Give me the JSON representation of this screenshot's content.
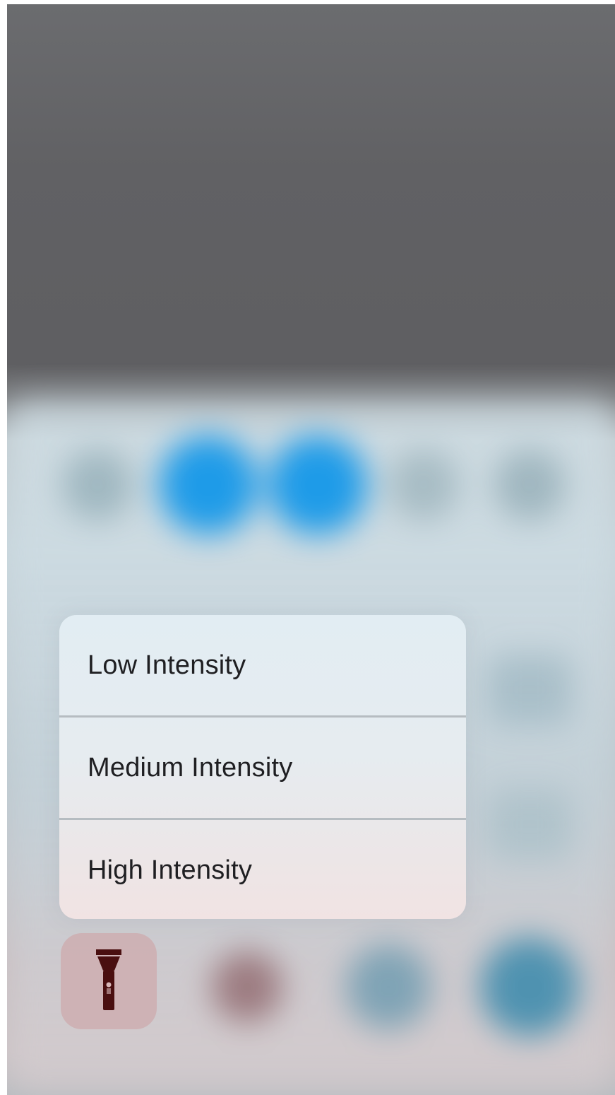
{
  "colors": {
    "accent_blue": "#1e9be8",
    "flashlight_icon": "#4a0f10",
    "menu_text": "#1f1f22",
    "divider": "#b6bcc1"
  },
  "intensity_menu": {
    "items": [
      {
        "label": "Low Intensity"
      },
      {
        "label": "Medium Intensity"
      },
      {
        "label": "High Intensity"
      }
    ]
  },
  "flashlight_tile": {
    "icon": "flashlight-icon"
  }
}
